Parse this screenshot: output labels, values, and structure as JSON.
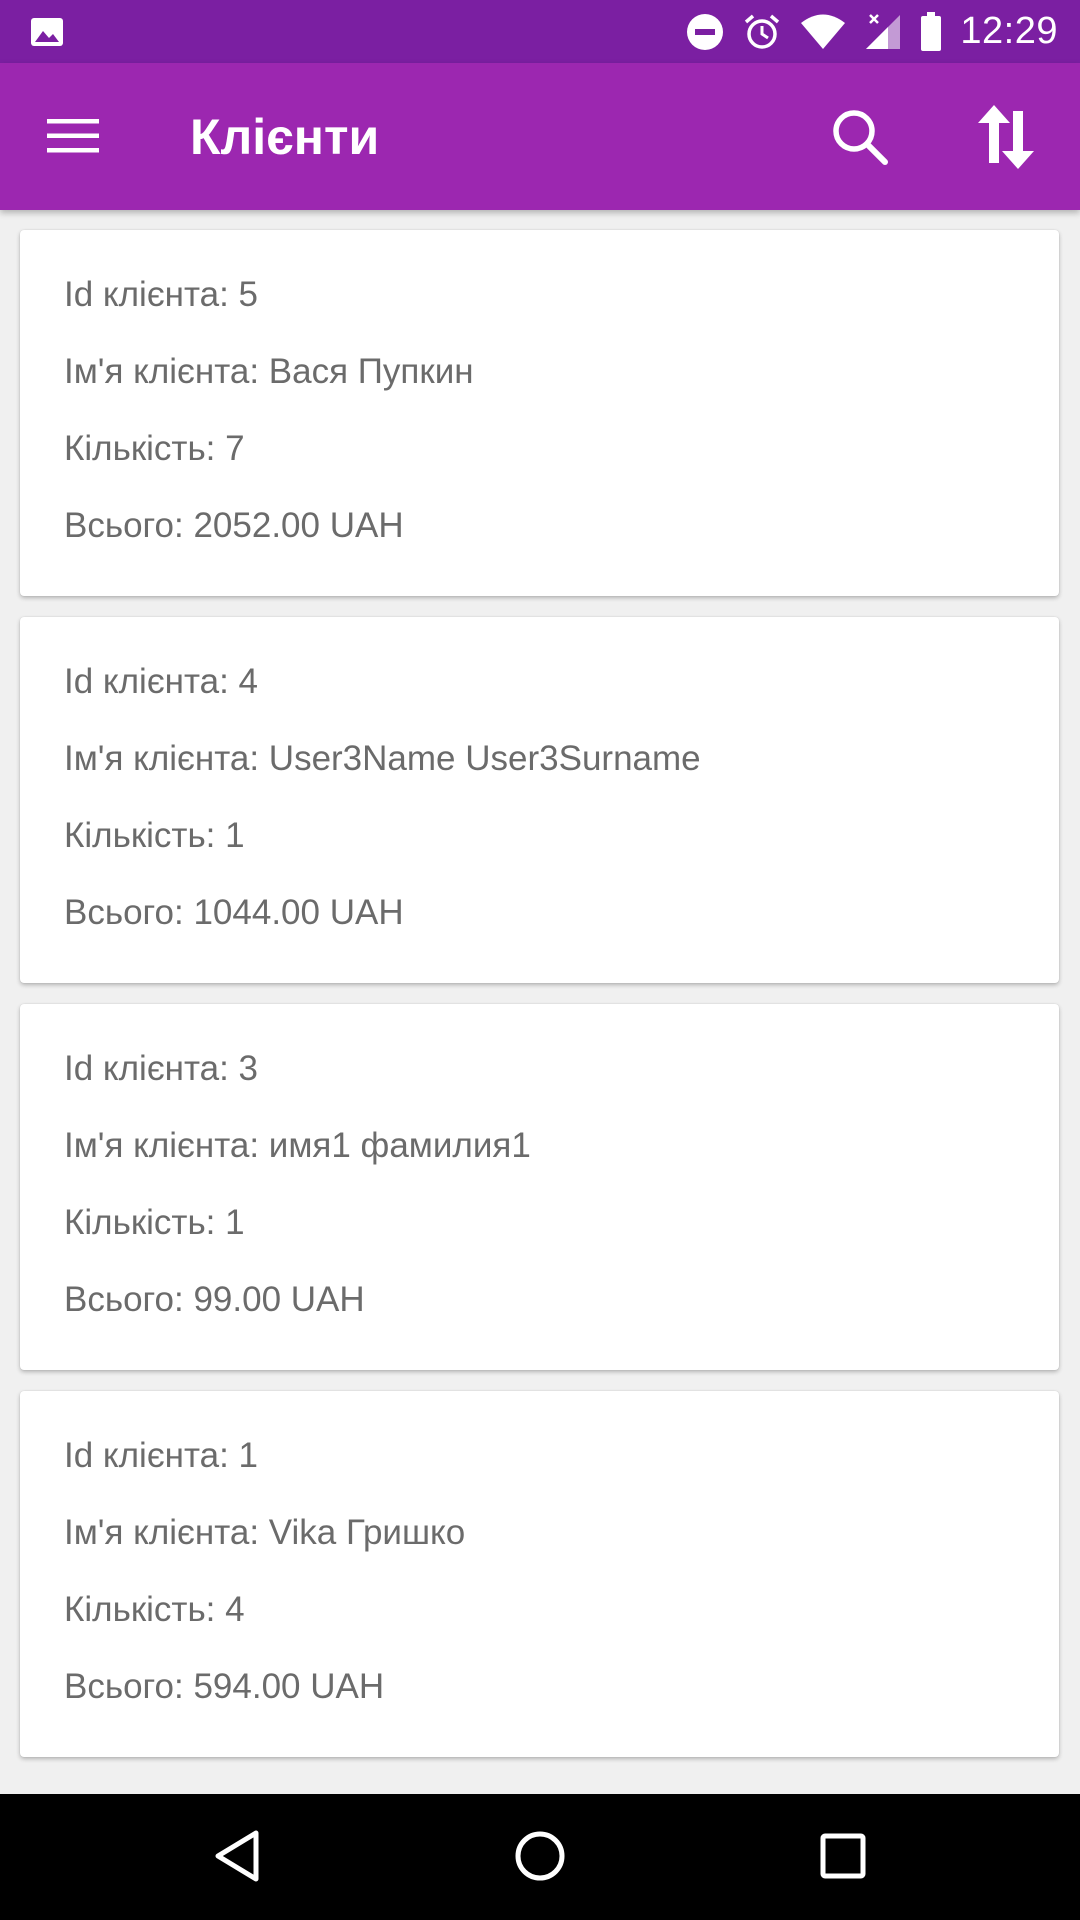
{
  "status_bar": {
    "time": "12:29",
    "left_icons": [
      "image-icon"
    ],
    "right_icons": [
      "do-not-disturb-icon",
      "alarm-icon",
      "wifi-icon",
      "signal-icon",
      "battery-icon"
    ]
  },
  "app_bar": {
    "title": "Клієнти",
    "icons": [
      "menu-icon",
      "search-icon",
      "sort-icon"
    ]
  },
  "clients": [
    {
      "id": "Id клієнта: 5",
      "name": "Ім'я клієнта: Вася Пупкин",
      "count": "Кількість: 7",
      "total": "Всього: 2052.00 UAH"
    },
    {
      "id": "Id клієнта: 4",
      "name": "Ім'я клієнта: User3Name User3Surname",
      "count": "Кількість: 1",
      "total": "Всього: 1044.00 UAH"
    },
    {
      "id": "Id клієнта: 3",
      "name": "Ім'я клієнта: имя1 фамилия1",
      "count": "Кількість: 1",
      "total": "Всього: 99.00 UAH"
    },
    {
      "id": "Id клієнта: 1",
      "name": "Ім'я клієнта: Vika Гришко",
      "count": "Кількість: 4",
      "total": "Всього: 594.00 UAH"
    }
  ],
  "nav_bar": {
    "icons": [
      "back-icon",
      "home-icon",
      "recents-icon"
    ]
  },
  "colors": {
    "status_bar": "#7b1fa2",
    "app_bar": "#9c27b0",
    "background": "#f0f0f0",
    "card_text": "#6b6b6b"
  }
}
